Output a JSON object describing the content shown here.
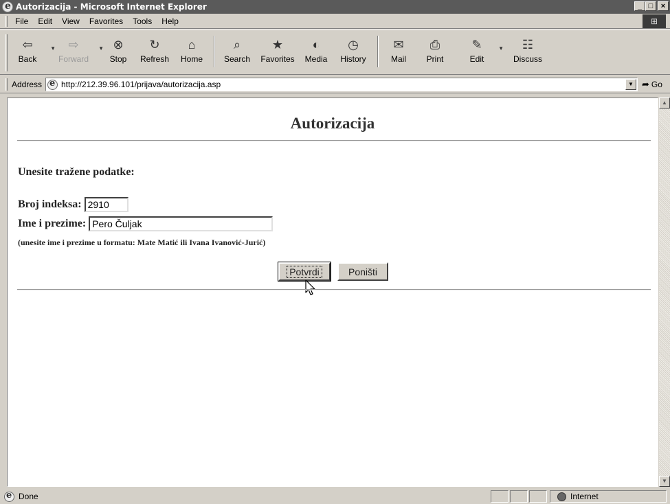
{
  "window": {
    "title": "Autorizacija - Microsoft Internet Explorer",
    "controls": {
      "minimize": "_",
      "maximize": "□",
      "close": "×"
    }
  },
  "menu": {
    "items": [
      "File",
      "Edit",
      "View",
      "Favorites",
      "Tools",
      "Help"
    ]
  },
  "toolbar": {
    "buttons": [
      {
        "label": "Back",
        "icon": "back-arrow-icon",
        "glyph": "⇦",
        "enabled": true
      },
      {
        "label": "Forward",
        "icon": "forward-arrow-icon",
        "glyph": "⇨",
        "enabled": false
      },
      {
        "label": "Stop",
        "icon": "stop-icon",
        "glyph": "⊗",
        "enabled": true
      },
      {
        "label": "Refresh",
        "icon": "refresh-icon",
        "glyph": "↻",
        "enabled": true
      },
      {
        "label": "Home",
        "icon": "home-icon",
        "glyph": "⌂",
        "enabled": true
      },
      {
        "label": "Search",
        "icon": "search-icon",
        "glyph": "⌕",
        "enabled": true
      },
      {
        "label": "Favorites",
        "icon": "favorites-icon",
        "glyph": "★",
        "enabled": true
      },
      {
        "label": "Media",
        "icon": "media-icon",
        "glyph": "◐",
        "enabled": true
      },
      {
        "label": "History",
        "icon": "history-icon",
        "glyph": "◷",
        "enabled": true
      },
      {
        "label": "Mail",
        "icon": "mail-icon",
        "glyph": "✉",
        "enabled": true
      },
      {
        "label": "Print",
        "icon": "print-icon",
        "glyph": "⎙",
        "enabled": true
      },
      {
        "label": "Edit",
        "icon": "edit-icon",
        "glyph": "✎",
        "enabled": true
      },
      {
        "label": "Discuss",
        "icon": "discuss-icon",
        "glyph": "☷",
        "enabled": true
      }
    ]
  },
  "address": {
    "label": "Address",
    "url": "http://212.39.96.101/prijava/autorizacija.asp",
    "go_label": "Go"
  },
  "page": {
    "heading": "Autorizacija",
    "prompt": "Unesite tražene podatke:",
    "index_label": "Broj indeksa:",
    "index_value": "2910",
    "name_label": "Ime i prezime:",
    "name_value": "Pero Čuljak",
    "hint": "(unesite ime i prezime u formatu: Mate Matić ili Ivana Ivanović-Jurić)",
    "submit_label": "Potvrdi",
    "reset_label": "Poništi"
  },
  "status": {
    "text": "Done",
    "zone": "Internet"
  }
}
